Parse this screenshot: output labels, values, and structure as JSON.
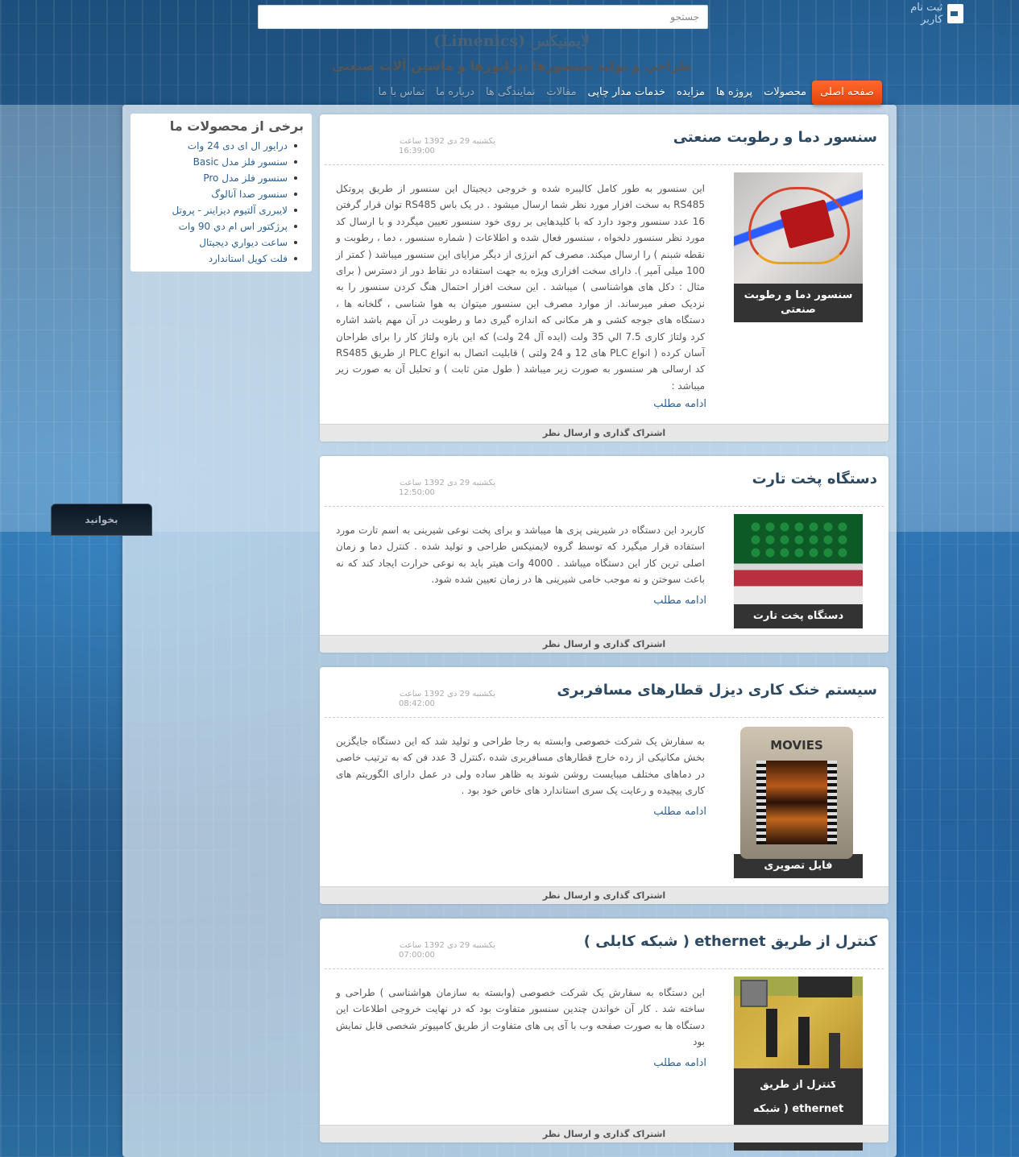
{
  "header": {
    "search_placeholder": "جستجو",
    "register_label": "ثبت نام کاربر",
    "site_title": "لایمنیکس (Limenics)",
    "site_subtitle": "طراحي و توليد سنسورها ،درايورها و ماشين آلات صنعتی"
  },
  "nav": {
    "items": [
      {
        "label": "صفحه اصلی",
        "active": true
      },
      {
        "label": "محصولات"
      },
      {
        "label": "پروژه ها"
      },
      {
        "label": "مزایده"
      },
      {
        "label": "خدمات مدار چاپی"
      },
      {
        "label": "مقالات"
      },
      {
        "label": "نمایندگی ها"
      },
      {
        "label": "درباره ما"
      },
      {
        "label": "تماس با ما"
      }
    ]
  },
  "sidebar": {
    "title": "برخی از محصولات ما",
    "items": [
      "درایور ال ای دی 24 وات",
      "سنسور فلز مدل Basic",
      "سنسور فلز مدل Pro",
      "سنسور صدا آنالوگ",
      "لایبرری آلتیوم دیزاینر - پروتل",
      "پرژکتور اس ام دي 90 وات",
      "ساعت ديواري ديجيتال",
      "فلت کویل استاندارد"
    ]
  },
  "read_tab": "بخوانید",
  "posts": [
    {
      "title": "سنسور دما و رطوبت صنعتی",
      "date_line1": "یکشنبه 29 دی 1392 ساعت",
      "date_line2": "16:39:00",
      "thumb_caption": "سنسور دما و رطوبت صنعتی",
      "body": "این سنسور به طور کامل کالیبره شده و خروجی دیجیتال این سنسور از طریق پروتکل RS485 به سخت افزار مورد نظر شما ارسال میشود . در یک باس RS485 توان قرار گرفتن 16 عدد سنسور وجود دارد که با کلیدهایی بر روی خود سنسور تعیین میگردد و با ارسال کد مورد نظر سنسور دلخواه ، سنسور فعال شده و اطلاعات ( شماره سنسور ، دما ، رطوبت و نقطه شبنم ) را ارسال میکند. مصرف کم انرژی از دیگر مزایای این سنسور میباشد ( کمتر از 100 میلی آمپر ). دارای سخت افزاری ویژه به جهت استفاده در نقاط دور از دسترس ( برای مثال : دکل های هواشناسی ) میباشد . این سخت افزار احتمال هنگ کردن سنسور را به نزدیک صفر میرساند. از موارد مصرف این سنسور میتوان به هوا شناسی ، گلخانه ها ، دستگاه های جوجه کشی و هر مکانی که اندازه گیری دما و رطوبت در آن مهم باشد اشاره کرد ولتاژ کاری 7.5 الي 35 ولت (ایده آل 24 ولت) که این بازه ولتاژ کار را برای طراحان آسان کرده ( انواع PLC های 12 و 24 ولتی ) قابلیت اتصال به انواع PLC از طریق RS485 کد ارسالی هر سنسور به صورت زیر میباشد ( طول متن ثابت ) و تحلیل آن به صورت زیر میباشد :",
      "read_more": "ادامه مطلب",
      "footer": "اشتراک گذاری و ارسال نظر"
    },
    {
      "title": "دستگاه پخت تارت",
      "date_line1": "یکشنبه 29 دی 1392 ساعت",
      "date_line2": "12:50:00",
      "thumb_caption": "دستگاه پخت تارت",
      "body": "کاربرد این دستگاه در شیرینی پزی ها میباشد و برای پخت نوعی شیرینی به اسم تارت مورد استفاده قرار میگیرد که توسط گروه لایمنیکس طراحی و تولید شده . کنترل دما و زمان اصلی ترین کار این دستگاه میباشد . 4000 وات هیتر باید به نوعی حرارت ایجاد کند که نه باعث سوختن و نه موجب خامی شیرینی ها در زمان تعیین شده شود.",
      "read_more": "ادامه مطلب",
      "footer": "اشتراک گذاری و ارسال نظر"
    },
    {
      "title": "سیستم خنک کاری دیزل قطارهای مسافربری",
      "date_line1": "یکشنبه 29 دی 1392 ساعت",
      "date_line2": "08:42:00",
      "thumb_caption": "فایل تصویری",
      "body": "به سفارش یک شرکت خصوصی وابسته به رجا طراحی و تولید شد که این دستگاه جایگزین بخش مکانیکی از رده خارج قطارهای مسافربری شده ،کنترل 3 عدد فن که به ترتیب خاصی در دماهای مختلف میبایست روشن شوند به ظاهر ساده ولی در عمل دارای الگوریتم های کاری پیچیده و رعایت یک سری استاندارد های خاص خود بود .",
      "read_more": "ادامه مطلب",
      "footer": "اشتراک گذاری و ارسال نظر"
    },
    {
      "title": "کنترل از طریق ethernet ( شبکه کابلی )",
      "date_line1": "یکشنبه 29 دی 1392 ساعت",
      "date_line2": "07:00:00",
      "thumb_caption": "کنترل از طریق ethernet ( شبکه کابلی )",
      "body": "این دستگاه به سفارش یک شرکت خصوصی (وابسته به سازمان هواشناسی ) طراحی و ساخته شد . کار آن خواندن چندین سنسور متفاوت بود که در نهایت خروجی اطلاعات این دستگاه ها به صورت صفحه وب با آی پی های متفاوت از طریق کامپیوتر شخصی قابل نمایش بود",
      "read_more": "ادامه مطلب",
      "footer": "اشتراک گذاری و ارسال نظر"
    }
  ]
}
